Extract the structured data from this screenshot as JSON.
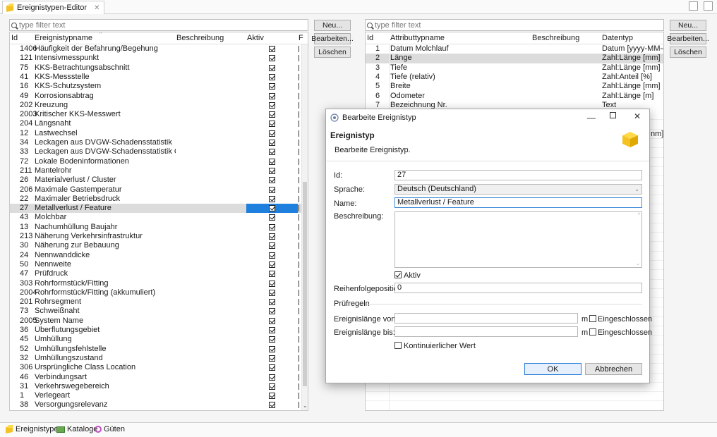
{
  "editor_tab": {
    "label": "Ereignistypen-Editor",
    "close": "✕"
  },
  "left_table": {
    "filter_placeholder": "type filter text",
    "columns": [
      "Id",
      "Ereignistypname",
      "Beschreibung",
      "Aktiv",
      "F"
    ],
    "rows": [
      {
        "id": "1406",
        "name": "Häufigkeit der Befahrung/Begehung"
      },
      {
        "id": "121",
        "name": "Intensivmesspunkt"
      },
      {
        "id": "75",
        "name": "KKS-Betrachtungsabschnitt"
      },
      {
        "id": "41",
        "name": "KKS-Messstelle"
      },
      {
        "id": "16",
        "name": "KKS-Schutzsystem"
      },
      {
        "id": "49",
        "name": "Korrosionsabtrag"
      },
      {
        "id": "202",
        "name": "Kreuzung"
      },
      {
        "id": "2003",
        "name": "Kritischer KKS-Messwert"
      },
      {
        "id": "204",
        "name": "Längsnaht"
      },
      {
        "id": "12",
        "name": "Lastwechsel"
      },
      {
        "id": "34",
        "name": "Leckagen aus DVGW-Schadensstatistik"
      },
      {
        "id": "33",
        "name": "Leckagen aus DVGW-Schadensstatistik Gesamtle..."
      },
      {
        "id": "72",
        "name": "Lokale Bodeninformationen"
      },
      {
        "id": "211",
        "name": "Mantelrohr"
      },
      {
        "id": "26",
        "name": "Materialverlust / Cluster"
      },
      {
        "id": "206",
        "name": "Maximale Gastemperatur"
      },
      {
        "id": "22",
        "name": "Maximaler Betriebsdruck"
      },
      {
        "id": "27",
        "name": "Metallverlust / Feature"
      },
      {
        "id": "43",
        "name": "Molchbar"
      },
      {
        "id": "13",
        "name": "Nachumhüllung Baujahr"
      },
      {
        "id": "213",
        "name": "Näherung Verkehrsinfrastruktur"
      },
      {
        "id": "30",
        "name": "Näherung zur Bebauung"
      },
      {
        "id": "24",
        "name": "Nennwanddicke"
      },
      {
        "id": "50",
        "name": "Nennweite"
      },
      {
        "id": "47",
        "name": "Prüfdruck"
      },
      {
        "id": "303",
        "name": "Rohrformstück/Fitting"
      },
      {
        "id": "2004",
        "name": "Rohrformstück/Fitting (akkumuliert)"
      },
      {
        "id": "201",
        "name": "Rohrsegment"
      },
      {
        "id": "73",
        "name": "Schweißnaht"
      },
      {
        "id": "2005",
        "name": "System Name"
      },
      {
        "id": "36",
        "name": "Überflutungsgebiet"
      },
      {
        "id": "45",
        "name": "Umhüllung"
      },
      {
        "id": "52",
        "name": "Umhüllungsfehlstelle"
      },
      {
        "id": "32",
        "name": "Umhüllungszustand"
      },
      {
        "id": "306",
        "name": "Ursprüngliche Class Location"
      },
      {
        "id": "46",
        "name": "Verbindungsart"
      },
      {
        "id": "31",
        "name": "Verkehrswegebereich"
      },
      {
        "id": "1",
        "name": "Verlegeart"
      },
      {
        "id": "38",
        "name": "Versorgungsrelevanz"
      }
    ],
    "selected_id": "27",
    "buttons": [
      "Neu...",
      "Bearbeiten...",
      "Löschen"
    ]
  },
  "right_table": {
    "filter_placeholder": "type filter text",
    "columns": [
      "Id",
      "Attributtypname",
      "Beschreibung",
      "Datentyp"
    ],
    "rows": [
      {
        "id": "1",
        "name": "Datum Molchlauf",
        "type": "Datum [yyyy-MM-dd]"
      },
      {
        "id": "2",
        "name": "Länge",
        "type": "Zahl:Länge [mm]"
      },
      {
        "id": "3",
        "name": "Tiefe",
        "type": "Zahl:Länge [mm]"
      },
      {
        "id": "4",
        "name": "Tiefe (relativ)",
        "type": "Zahl:Anteil [%]"
      },
      {
        "id": "5",
        "name": "Breite",
        "type": "Zahl:Länge [mm]"
      },
      {
        "id": "6",
        "name": "Odometer",
        "type": "Zahl:Länge [m]"
      },
      {
        "id": "7",
        "name": "Bezeichnung Nr.",
        "type": "Text"
      }
    ],
    "hidden_fragment": "nm]",
    "buttons": [
      "Neu...",
      "Bearbeiten...",
      "Löschen"
    ]
  },
  "dialog": {
    "title": "Bearbeite Ereignistyp",
    "heading": "Ereignistyp",
    "subheading": "Bearbeite Ereignistyp.",
    "id_label": "Id:",
    "id_value": "27",
    "lang_label": "Sprache:",
    "lang_value": "Deutsch (Deutschland)",
    "name_label": "Name:",
    "name_value": "Metallverlust / Feature",
    "desc_label": "Beschreibung:",
    "aktiv_label": "Aktiv",
    "order_label": "Reihenfolgeposition:",
    "order_value": "0",
    "section": "Prüfregeln",
    "from_label": "Ereignislänge von:",
    "to_label": "Ereignislänge bis:",
    "unit": "m",
    "incl_label": "Eingeschlossen",
    "cont_label": "Kontinuierlicher Wert",
    "ok": "OK",
    "cancel": "Abbrechen"
  },
  "bottom_tabs": [
    "Ereignistypen",
    "Kataloge",
    "Güten"
  ]
}
